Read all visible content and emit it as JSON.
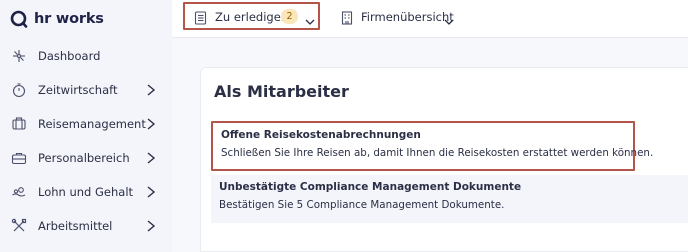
{
  "brand": {
    "logo_text": "hr works"
  },
  "sidebar": {
    "items": [
      {
        "label": "Dashboard",
        "icon": "dashboard-icon",
        "has_chevron": false
      },
      {
        "label": "Zeitwirtschaft",
        "icon": "stopwatch-icon",
        "has_chevron": true
      },
      {
        "label": "Reisemanagement",
        "icon": "travel-icon",
        "has_chevron": true
      },
      {
        "label": "Personalbereich",
        "icon": "briefcase-icon",
        "has_chevron": true
      },
      {
        "label": "Lohn und Gehalt",
        "icon": "money-icon",
        "has_chevron": true
      },
      {
        "label": "Arbeitsmittel",
        "icon": "tools-icon",
        "has_chevron": true
      }
    ]
  },
  "topbar": {
    "todo_label": "Zu erledigen",
    "todo_count": "2",
    "company_label": "Firmenübersicht"
  },
  "main": {
    "section_title": "Als Mitarbeiter",
    "tasks": [
      {
        "title": "Offene Reisekostenabrechnungen",
        "description": "Schließen Sie Ihre Reisen ab, damit Ihnen die Reisekosten erstattet werden können."
      },
      {
        "title": "Unbestätigte Compliance Management Dokumente",
        "description": "Bestätigen Sie 5 Compliance Management Dokumente."
      }
    ]
  },
  "colors": {
    "highlight_border": "#b5544a",
    "badge_bg": "#fbe6b9",
    "sidebar_bg": "#f4f5fb",
    "text": "#2b2f45"
  }
}
